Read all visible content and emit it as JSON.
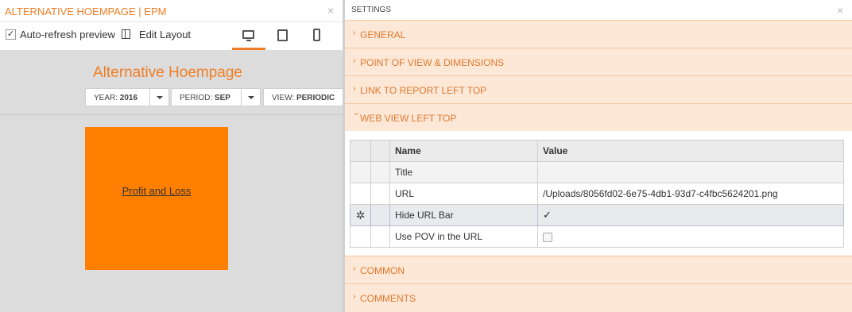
{
  "left_panel": {
    "title": "ALTERNATIVE HOEMPAGE | EPM",
    "toolbar": {
      "auto_refresh_label": "Auto-refresh preview",
      "auto_refresh_checked": true,
      "edit_layout_label": "Edit Layout",
      "devices": [
        "desktop-icon",
        "tablet-icon",
        "phone-icon"
      ],
      "active_device": "desktop"
    },
    "preview": {
      "title": "Alternative Hoempage",
      "pov": [
        {
          "key": "YEAR:",
          "value": "2016"
        },
        {
          "key": "PERIOD:",
          "value": "SEP"
        },
        {
          "key": "VIEW:",
          "value": "PERIODIC"
        }
      ],
      "tile_link": "Profit and Loss",
      "tile_color": "#ff7f00"
    }
  },
  "right_panel": {
    "title": "SETTINGS",
    "sections": [
      {
        "label": "GENERAL",
        "expanded": false
      },
      {
        "label": "POINT OF VIEW & DIMENSIONS",
        "expanded": false
      },
      {
        "label": "LINK TO REPORT LEFT TOP",
        "expanded": false
      },
      {
        "label": "WEB VIEW LEFT TOP",
        "expanded": true
      },
      {
        "label": "COMMON",
        "expanded": false
      },
      {
        "label": "COMMENTS",
        "expanded": false
      }
    ],
    "grid": {
      "headers": {
        "name": "Name",
        "value": "Value"
      },
      "rows": [
        {
          "name": "Title",
          "value": ""
        },
        {
          "name": "URL",
          "value": "/Uploads/8056fd02-6e75-4db1-93d7-c4fbc5624201.png"
        },
        {
          "name": "Hide URL Bar",
          "value": "✓"
        },
        {
          "name": "Use POV in the URL",
          "value": ""
        }
      ],
      "selected_row": "Hide URL Bar"
    }
  },
  "colors": {
    "accent": "#f07e26",
    "section_bg": "#fde7d6",
    "preview_bg": "#dcdcdc"
  },
  "glyphs": {
    "close": "×",
    "check": "✓",
    "chev_right": "›",
    "chev_down": "⌄",
    "gear": "✲"
  }
}
